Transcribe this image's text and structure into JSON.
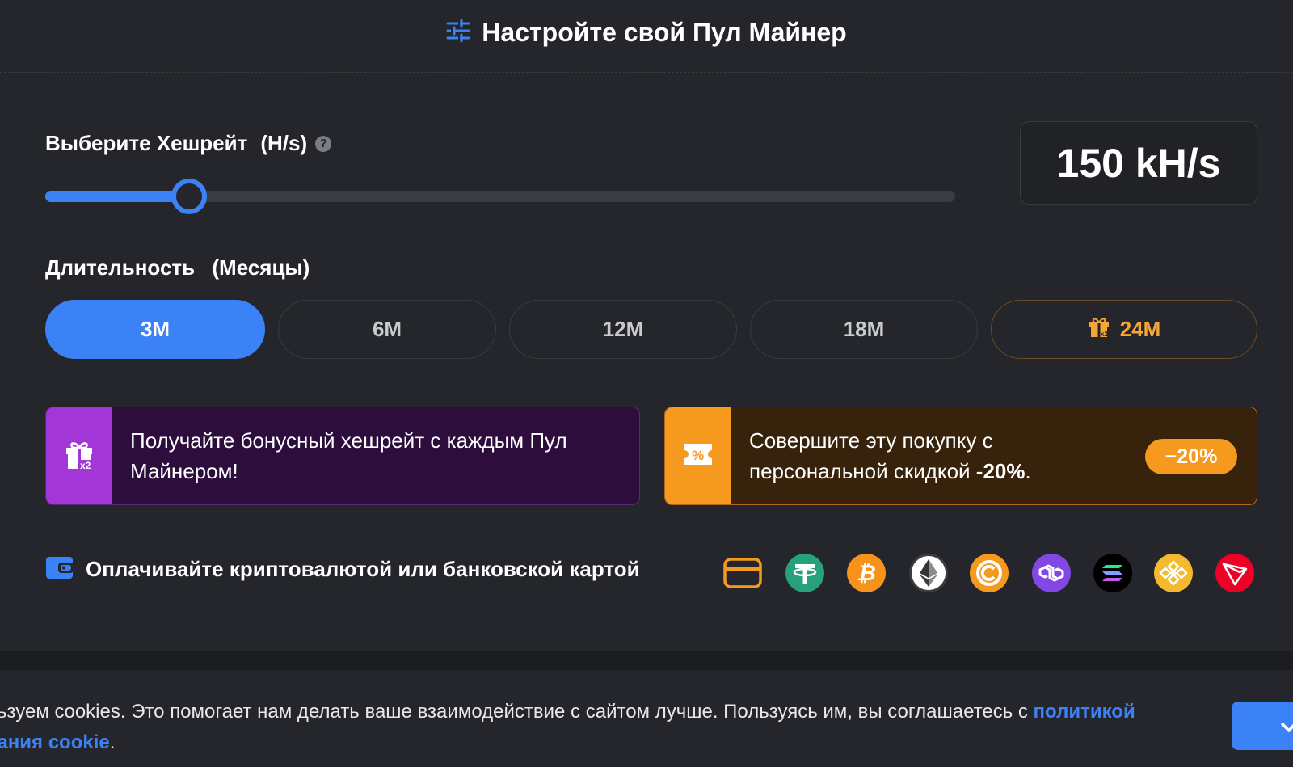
{
  "header": {
    "title": "Настройте свой Пул Майнер",
    "icon": "sliders-icon"
  },
  "hashrate": {
    "label": "Выберите Хешрейт",
    "unit": "(H/s)",
    "help_icon": "?",
    "value_display": "150 kH/s",
    "slider_fraction": 0.158
  },
  "duration": {
    "label": "Длительность",
    "unit": "(Месяцы)",
    "options": [
      {
        "label": "3M",
        "selected": true
      },
      {
        "label": "6M",
        "selected": false
      },
      {
        "label": "12M",
        "selected": false
      },
      {
        "label": "18M",
        "selected": false
      },
      {
        "label": "24M",
        "selected": false,
        "icon": "gift-x2-icon"
      }
    ]
  },
  "promos": {
    "bonus": {
      "text": "Получайте бонусный хешрейт с каждым Пул Майнером!",
      "icon": "gift-x2-icon",
      "accent": "#a336d6"
    },
    "discount": {
      "text_prefix": "Совершите эту покупку с персональной скидкой ",
      "text_bold": "-20%",
      "text_suffix": ".",
      "badge": "−20%",
      "icon": "discount-ticket-icon",
      "accent": "#f59a1f"
    }
  },
  "payment": {
    "label": "Оплачивайте криптовалютой или банковской картой",
    "icon": "wallet-icon",
    "methods": [
      "bank-card-icon",
      "tether-icon",
      "bitcoin-icon",
      "ethereum-icon",
      "coin-c-icon",
      "polygon-icon",
      "solana-icon",
      "bnb-icon",
      "tron-icon"
    ]
  },
  "cookie": {
    "line1_text": "льзуем cookies. Это помогает нам делать ваше взаимодействие с сайтом лучше. Пользуясь им, вы соглашаетесь с ",
    "line1_link": "политикой",
    "line2_link": "вания cookie",
    "line2_text": ".",
    "accept_icon": "check-icon"
  },
  "colors": {
    "accent": "#3b82f6",
    "background": "#24262b",
    "orange": "#f59a1f",
    "purple": "#a336d6"
  }
}
